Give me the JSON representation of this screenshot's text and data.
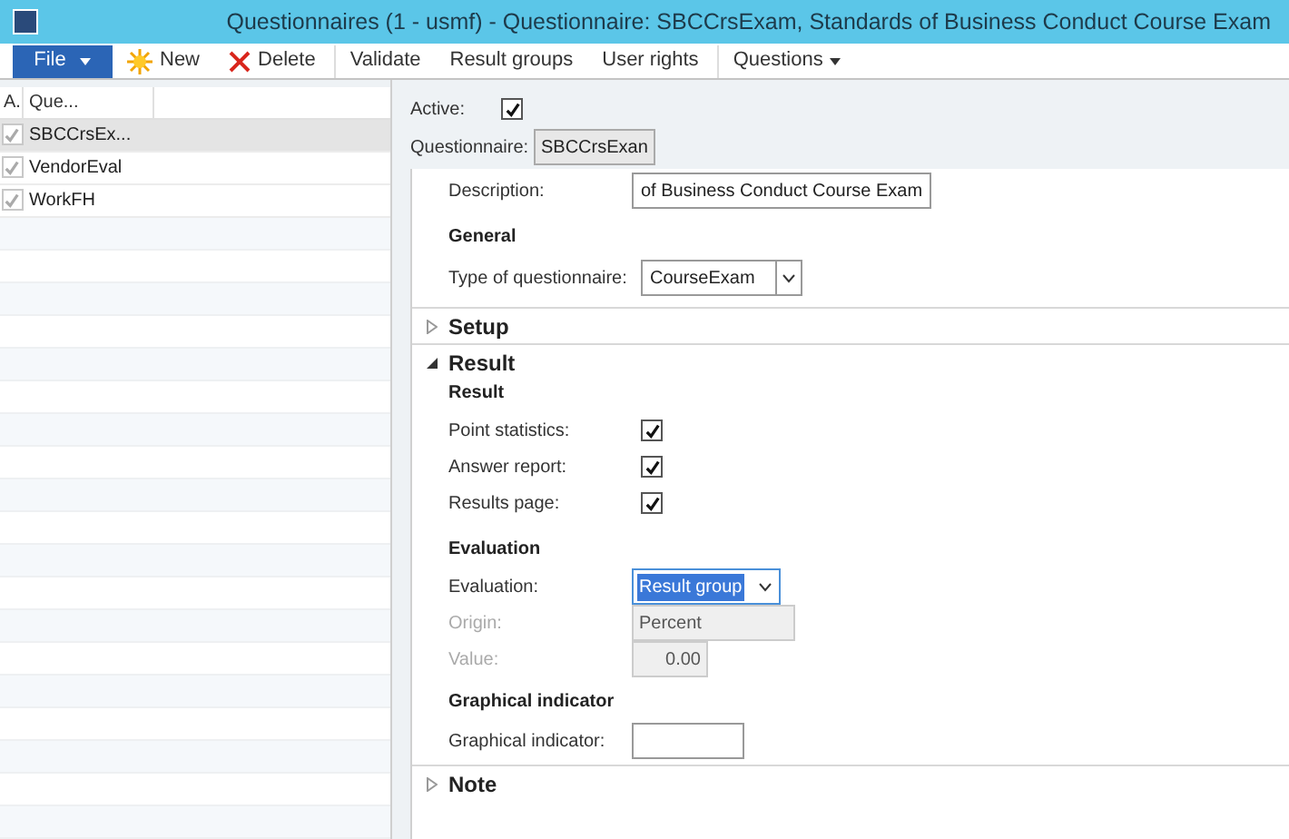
{
  "window": {
    "title": "Questionnaires (1 - usmf) - Questionnaire: SBCCrsExam, Standards of Business Conduct Course Exam"
  },
  "toolbar": {
    "file": "File",
    "buttons": [
      {
        "label": "New",
        "kind": "new"
      },
      {
        "label": "Delete",
        "kind": "delete"
      },
      {
        "label": "Validate",
        "kind": "plain"
      },
      {
        "label": "Result groups",
        "kind": "plain"
      },
      {
        "label": "User rights",
        "kind": "plain"
      },
      {
        "label": "Questions",
        "kind": "menu"
      }
    ]
  },
  "grid": {
    "columns": [
      "A.",
      "Que..."
    ],
    "rows": [
      {
        "name": "SBCCrsEx...",
        "checked": true,
        "selected": true
      },
      {
        "name": "VendorEval",
        "checked": true,
        "selected": false
      },
      {
        "name": "WorkFH",
        "checked": true,
        "selected": false
      }
    ]
  },
  "header": {
    "active_label": "Active:",
    "active": true,
    "questionnaire_label": "Questionnaire:",
    "questionnaire": "SBCCrsExan"
  },
  "description": {
    "label": "Description:",
    "value": "of Business Conduct Course Exam"
  },
  "general": {
    "title": "General",
    "type_label": "Type of questionnaire:",
    "type_value": "CourseExam"
  },
  "sections": [
    {
      "title": "Setup",
      "expanded": false
    },
    {
      "title": "Result",
      "expanded": true
    },
    {
      "title": "Note",
      "expanded": false
    }
  ],
  "result": {
    "title": "Result",
    "checks": [
      {
        "label": "Point statistics:",
        "checked": true
      },
      {
        "label": "Answer report:",
        "checked": true
      },
      {
        "label": "Results page:",
        "checked": true
      }
    ]
  },
  "evaluation": {
    "title": "Evaluation",
    "fields": [
      {
        "label": "Evaluation:",
        "value": "Result group",
        "kind": "combo",
        "disabled": false
      },
      {
        "label": "Origin:",
        "value": "Percent",
        "kind": "text",
        "disabled": true
      },
      {
        "label": "Value:",
        "value": "0.00",
        "kind": "number",
        "disabled": true
      }
    ]
  },
  "graphical": {
    "title": "Graphical indicator",
    "label": "Graphical indicator:"
  }
}
